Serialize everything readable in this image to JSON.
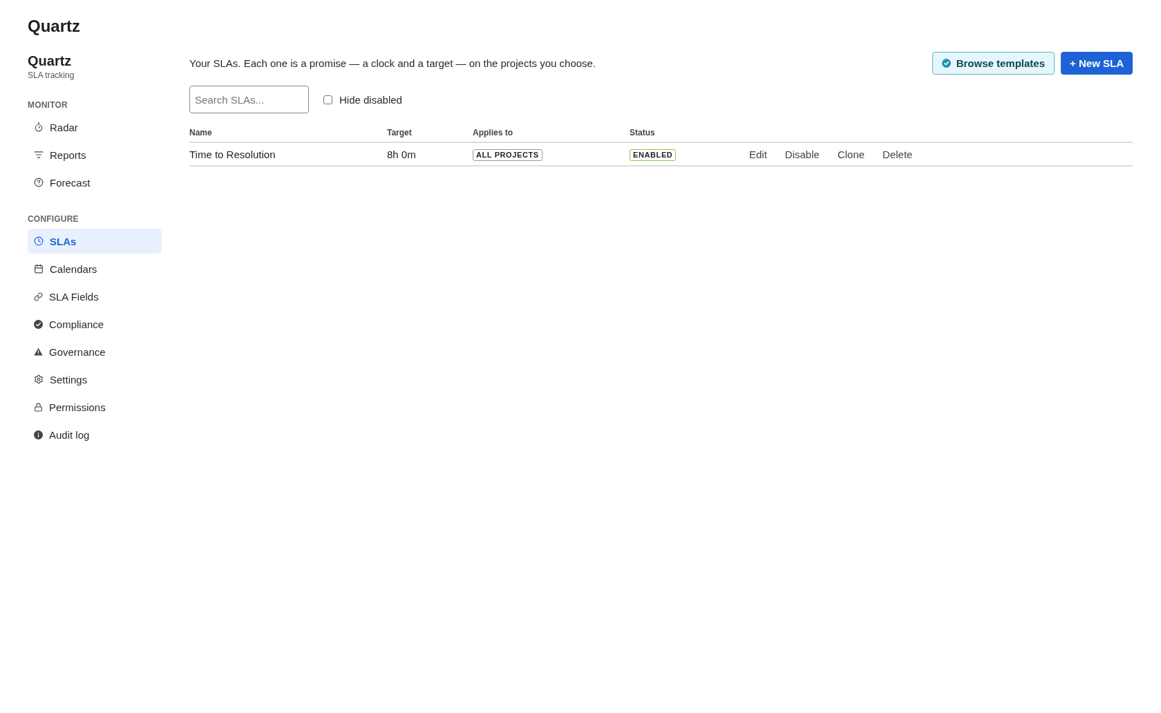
{
  "app": {
    "title": "Quartz"
  },
  "sidebar": {
    "brand": {
      "title": "Quartz",
      "subtitle": "SLA tracking"
    },
    "sections": [
      {
        "label": "MONITOR",
        "items": [
          {
            "label": "Radar",
            "selected": false
          },
          {
            "label": "Reports",
            "selected": false
          },
          {
            "label": "Forecast",
            "selected": false
          }
        ]
      },
      {
        "label": "CONFIGURE",
        "items": [
          {
            "label": "SLAs",
            "selected": true
          },
          {
            "label": "Calendars",
            "selected": false
          },
          {
            "label": "SLA Fields",
            "selected": false
          },
          {
            "label": "Compliance",
            "selected": false
          },
          {
            "label": "Governance",
            "selected": false
          },
          {
            "label": "Settings",
            "selected": false
          },
          {
            "label": "Permissions",
            "selected": false
          },
          {
            "label": "Audit log",
            "selected": false
          }
        ]
      }
    ]
  },
  "main": {
    "intro": "Your SLAs. Each one is a promise — a clock and a target — on the projects you choose.",
    "actions": [
      {
        "label": "Browse templates",
        "kind": "secondary"
      },
      {
        "label": "+ New SLA",
        "kind": "primary"
      }
    ],
    "search": {
      "placeholder": "Search SLAs..."
    },
    "filter": {
      "label": "Hide disabled",
      "checked": false
    },
    "table": {
      "columns": [
        "Name",
        "Target",
        "Applies to",
        "Status"
      ],
      "rows": [
        {
          "name": "Time to Resolution",
          "target": "8h 0m",
          "applies_to": "ALL PROJECTS",
          "status": {
            "label": "ENABLED",
            "color": "#8ec74f"
          },
          "actions": [
            "Edit",
            "Disable",
            "Clone",
            "Delete"
          ]
        }
      ]
    }
  }
}
